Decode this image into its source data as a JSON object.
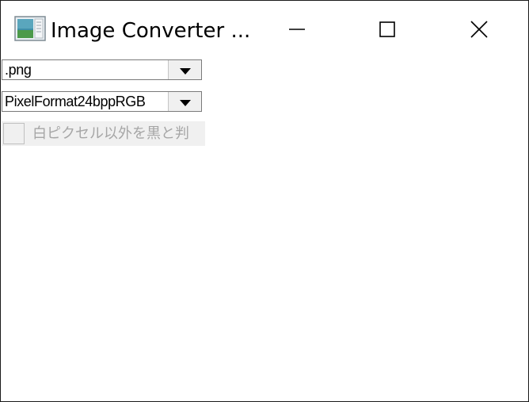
{
  "window": {
    "title": "Image Converter ...",
    "icon": "image-converter-app-icon",
    "controls": {
      "minimize_icon": "minimize-icon",
      "maximize_icon": "maximize-icon",
      "close_icon": "close-icon"
    }
  },
  "form": {
    "extension_select": {
      "value": ".png",
      "arrow_icon": "dropdown-arrow-icon"
    },
    "pixel_format_select": {
      "value": "PixelFormat24bppRGB",
      "arrow_icon": "dropdown-arrow-icon"
    },
    "binarize_checkbox": {
      "label": "白ピクセル以外を黒と判",
      "checked": false,
      "enabled": false
    }
  },
  "colors": {
    "disabled_text": "#a6a6a6",
    "disabled_bg": "#f0f0f0",
    "window_border": "#1a1a1a"
  }
}
